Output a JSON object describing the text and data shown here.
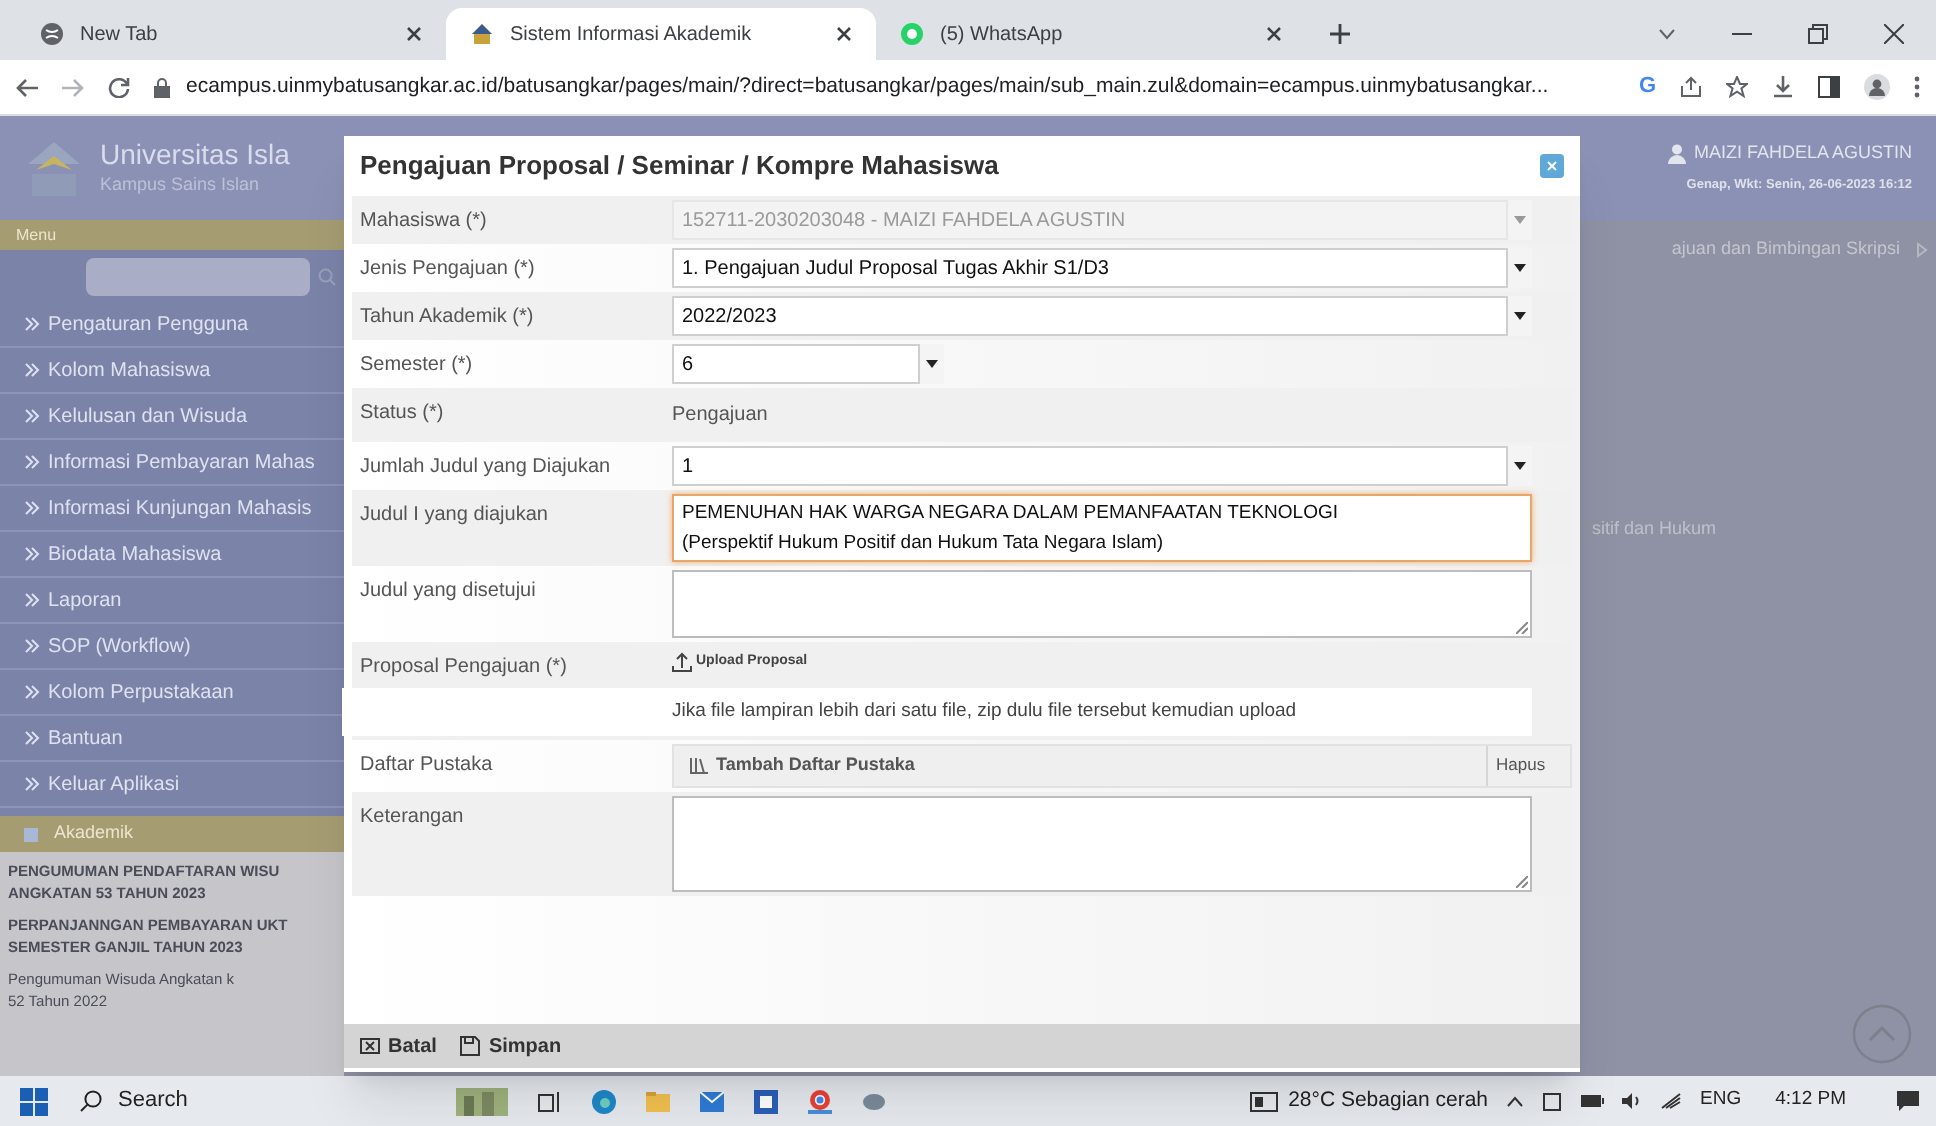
{
  "browser": {
    "tabs": [
      {
        "title": "New Tab",
        "selected": false
      },
      {
        "title": "Sistem Informasi Akademik",
        "selected": true
      },
      {
        "title": "(5) WhatsApp",
        "selected": false
      }
    ],
    "url": "ecampus.uinmybatusangkar.ac.id/batusangkar/pages/main/?direct=batusangkar/pages/main/sub_main.zul&domain=ecampus.uinmybatusangkar...",
    "profile_letter": "G"
  },
  "sidebar": {
    "title": "Universitas Isla",
    "subtitle": "Kampus Sains Islan",
    "menu_label": "Menu",
    "items": [
      "Pengaturan Pengguna",
      "Kolom Mahasiswa",
      "Kelulusan dan Wisuda",
      "Informasi Pembayaran Mahas",
      "Informasi Kunjungan Mahasis",
      "Biodata Mahasiswa",
      "Laporan",
      "SOP (Workflow)",
      "Kolom Perpustakaan",
      "Bantuan",
      "Keluar Aplikasi"
    ],
    "section": "Akademik",
    "announcements": [
      {
        "lines": [
          "PENGUMUMAN PENDAFTARAN WISU",
          "ANGKATAN 53 TAHUN 2023"
        ],
        "bold": true
      },
      {
        "lines": [
          "PERPANJANNGAN PEMBAYARAN UKT",
          "SEMESTER GANJIL TAHUN 2023"
        ],
        "bold": true
      },
      {
        "lines": [
          "Pengumuman Wisuda Angkatan k",
          "52 Tahun 2022"
        ],
        "bold": false
      }
    ]
  },
  "header": {
    "user": "MAIZI FAHDELA AGUSTIN",
    "session": "Genap, Wkt: Senin, 26-06-2023 16:12"
  },
  "background": {
    "tab_label": "ajuan dan Bimbingan Skripsi",
    "text": "sitif dan Hukum"
  },
  "dialog": {
    "title": "Pengajuan Proposal / Seminar / Kompre Mahasiswa",
    "fields": [
      {
        "kind": "select",
        "label": "Mahasiswa (*)",
        "value": "152711-2030203048 - MAIZI FAHDELA AGUSTIN",
        "disabled": true,
        "wide": true
      },
      {
        "kind": "select",
        "label": "Jenis Pengajuan (*)",
        "value": "1. Pengajuan Judul Proposal Tugas Akhir S1/D3",
        "disabled": false,
        "wide": true
      },
      {
        "kind": "select",
        "label": "Tahun Akademik (*)",
        "value": "2022/2023",
        "disabled": false,
        "wide": true
      },
      {
        "kind": "select",
        "label": "Semester (*)",
        "value": "6",
        "disabled": false,
        "wide": false
      },
      {
        "kind": "text",
        "label": "Status (*)",
        "value": "Pengajuan"
      },
      {
        "kind": "select",
        "label": "Jumlah Judul yang Diajukan",
        "value": "1",
        "disabled": false,
        "wide": true
      },
      {
        "kind": "textarea",
        "label": "Judul I yang diajukan",
        "value": "PEMENUHAN HAK WARGA NEGARA DALAM PEMANFAATAN TEKNOLOGI\n(Perspektif Hukum Positif dan Hukum Tata Negara Islam)",
        "focused": true
      },
      {
        "kind": "textarea",
        "label": "Judul yang disetujui",
        "focused": false
      },
      {
        "kind": "upload",
        "label": "Proposal Pengajuan (*)",
        "button": "Upload Proposal",
        "note": "Jika file lampiran lebih dari satu file, zip dulu file tersebut kemudian upload"
      },
      {
        "kind": "list",
        "label": "Daftar Pustaka",
        "button": "Tambah Daftar Pustaka",
        "remove": "Hapus"
      },
      {
        "kind": "textarea",
        "label": "Keterangan",
        "focused": false
      }
    ],
    "buttons": [
      {
        "label": "Batal"
      },
      {
        "label": "Simpan"
      }
    ]
  },
  "taskbar": {
    "search": "Search",
    "weather": "28°C Sebagian cerah",
    "language": "ENG",
    "time": "4:12 PM"
  }
}
